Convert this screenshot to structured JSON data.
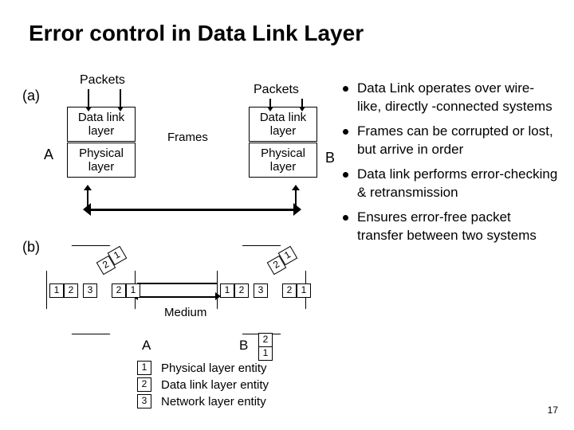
{
  "title": "Error control in Data Link Layer",
  "panel_a": "(a)",
  "panel_b": "(b)",
  "packets": "Packets",
  "frames": "Frames",
  "medium": "Medium",
  "node_A": "A",
  "node_B": "B",
  "stack": {
    "datalink": "Data link layer",
    "physical": "Physical layer"
  },
  "legend": {
    "1": "Physical layer entity",
    "2": "Data link layer entity",
    "3": "Network layer entity"
  },
  "numbers": {
    "n1": "1",
    "n2": "2",
    "n3": "3"
  },
  "bullets": [
    "Data Link operates over wire-like, directly -connected systems",
    "Frames can be corrupted or lost, but arrive in order",
    "Data link performs error-checking & retransmission",
    "Ensures error-free packet transfer between two systems"
  ],
  "page": "17"
}
